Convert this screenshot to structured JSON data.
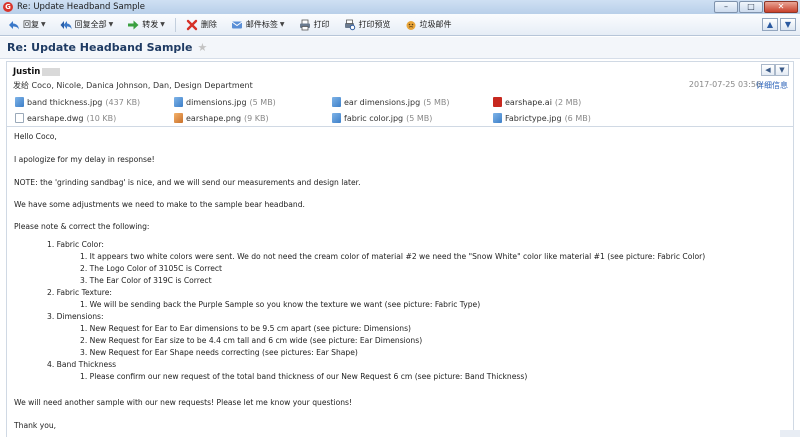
{
  "window": {
    "app_icon": "G",
    "title": "Re: Update Headband Sample",
    "minimize": "–",
    "maximize": "□",
    "close": "✕"
  },
  "toolbar": {
    "reply": "回复",
    "reply_all": "回复全部",
    "forward": "转发",
    "delete": "删除",
    "tag": "邮件标签",
    "print": "打印",
    "print_preview": "打印预览",
    "junk": "垃圾邮件",
    "dropdown_arrow": "▼",
    "up": "▲",
    "down": "▼"
  },
  "subject": {
    "text": "Re: Update Headband Sample",
    "star": "★"
  },
  "header": {
    "sender": "Justin",
    "recipients": "发给 Coco, Nicole, Danica Johnson, Dan, Design Department",
    "date": "2017-07-25 03:56",
    "details": "详细信息",
    "reply_icon": "◀",
    "more_icon": "▼"
  },
  "attachments": [
    {
      "name": "band thickness.jpg",
      "size": "(437 KB)",
      "type": "jpg"
    },
    {
      "name": "dimensions.jpg",
      "size": "(5 MB)",
      "type": "jpg"
    },
    {
      "name": "ear dimensions.jpg",
      "size": "(5 MB)",
      "type": "jpg"
    },
    {
      "name": "earshape.ai",
      "size": "(2 MB)",
      "type": "ai"
    },
    {
      "name": "earshape.dwg",
      "size": "(10 KB)",
      "type": "dwg"
    },
    {
      "name": "earshape.png",
      "size": "(9 KB)",
      "type": "png"
    },
    {
      "name": "fabric color.jpg",
      "size": "(5 MB)",
      "type": "jpg"
    },
    {
      "name": "Fabrictype.jpg",
      "size": "(6 MB)",
      "type": "jpg"
    }
  ],
  "body": [
    "Hello Coco,",
    "I apologize for my delay in response!",
    "NOTE: the 'grinding sandbag' is nice, and we will send our measurements and design later.",
    "We have some adjustments we need to make to the sample bear headband.",
    "Please note & correct the following:",
    "1. Fabric Color:",
    "1. It appears two white colors were sent. We do not need the cream color of material #2 we need the \"Snow White\" color like material #1 (see picture: Fabric Color)",
    "2. The Logo Color of 3105C is Correct",
    "3. The Ear Color of 319C is Correct",
    "2. Fabric Texture:",
    "1. We will be sending back the Purple Sample so you know the texture we want (see picture: Fabric Type)",
    "3. Dimensions:",
    "1. New Request for Ear to Ear dimensions to be 9.5 cm apart (see picture: Dimensions)",
    "2. New Request for Ear size to be 4.4 cm tall and 6 cm wide (see picture: Ear Dimensions)",
    "3. New Request for Ear Shape needs correcting (see pictures: Ear Shape)",
    "4. Band Thickness",
    "1. Please confirm our new request of the total band thickness of our New Request 6 cm (see picture: Band Thickness)",
    "We will need another sample with our new requests! Please let me know your questions!",
    "Thank you,"
  ]
}
